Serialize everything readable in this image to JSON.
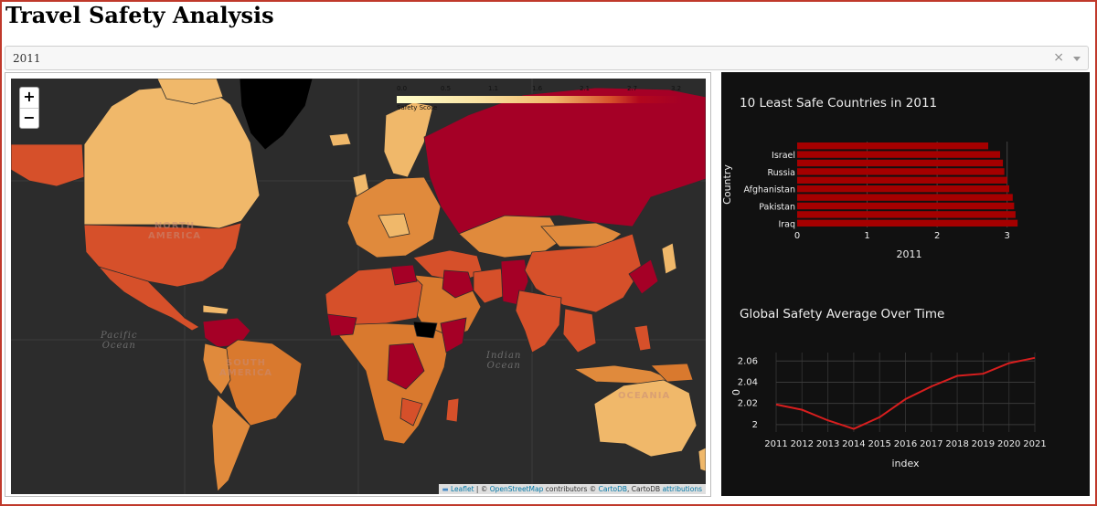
{
  "page": {
    "title": "Travel Safety Analysis"
  },
  "year_select": {
    "value": "2011",
    "clear_icon": "×"
  },
  "map": {
    "zoom_in": "+",
    "zoom_out": "−",
    "legend": {
      "ticks": [
        "0.0",
        "0.5",
        "1.1",
        "1.6",
        "2.1",
        "2.7",
        "3.2"
      ],
      "caption": "Safety Score"
    },
    "labels": {
      "north_america": "NORTH\nAMERICA",
      "south_america": "SOUTH\nAMERICA",
      "oceania": "OCEANIA",
      "pacific": "Pacific\nOcean",
      "indian": "Indian\nOcean"
    },
    "attribution": {
      "leaflet": "Leaflet",
      "sep1": " | © ",
      "osm": "OpenStreetMap",
      "contributors": " contributors © ",
      "cartodb": "CartoDB",
      "sep2": ", CartoDB ",
      "attributions": "attributions"
    },
    "colors": {
      "low": "#f0b86a",
      "mid": "#d6502a",
      "high": "#a50026",
      "none": "#000000"
    }
  },
  "chart_data": [
    {
      "type": "bar",
      "orientation": "horizontal",
      "title": "10 Least Safe Countries in 2011",
      "xlabel": "2011",
      "ylabel": "Country",
      "xlim": [
        0,
        3.2
      ],
      "xticks": [
        0,
        1,
        2,
        3
      ],
      "categories": [
        "Iraq",
        "",
        "Pakistan",
        "",
        "Afghanistan",
        "",
        "Russia",
        "",
        "Israel",
        ""
      ],
      "values": [
        3.15,
        3.12,
        3.1,
        3.08,
        3.03,
        3.0,
        2.96,
        2.94,
        2.9,
        2.73
      ],
      "color": "#a50000"
    },
    {
      "type": "line",
      "title": "Global Safety Average Over Time",
      "xlabel": "index",
      "ylabel": "0",
      "x": [
        2011,
        2012,
        2013,
        2014,
        2015,
        2016,
        2017,
        2018,
        2019,
        2020,
        2021
      ],
      "y": [
        2.019,
        2.014,
        2.004,
        1.996,
        2.007,
        2.024,
        2.036,
        2.046,
        2.048,
        2.058,
        2.063
      ],
      "ylim": [
        1.993,
        2.068
      ],
      "yticks": [
        2,
        2.02,
        2.04,
        2.06
      ],
      "color": "#d81e1e"
    }
  ]
}
